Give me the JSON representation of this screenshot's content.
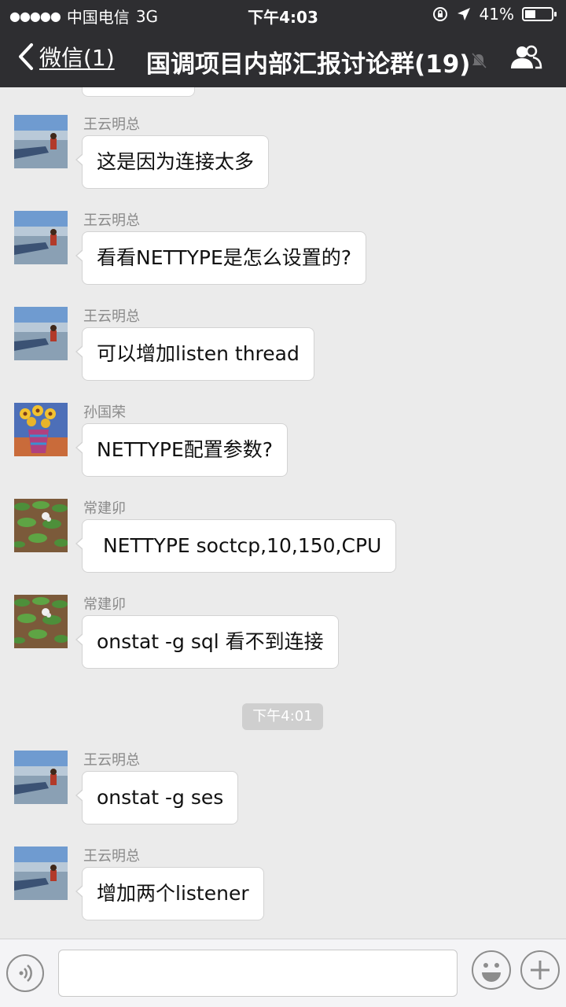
{
  "status_bar": {
    "signal_dots": "●●●●●",
    "carrier": "中国电信",
    "network": "3G",
    "time": "下午4:03",
    "battery_percent": "41%",
    "battery_level": 0.41
  },
  "nav": {
    "back_label": "微信(1)",
    "title": "国调项目内部汇报讨论群(19)"
  },
  "messages": [
    {
      "sender": "王云明总",
      "text": "这是因为连接太多",
      "avatar": "lake-avatar"
    },
    {
      "sender": "王云明总",
      "text": "看看NETTYPE是怎么设置的?",
      "avatar": "lake-avatar"
    },
    {
      "sender": "王云明总",
      "text": "可以增加listen thread",
      "avatar": "lake-avatar"
    },
    {
      "sender": "孙国荣",
      "text": "NETTYPE配置参数?",
      "avatar": "flower-avatar"
    },
    {
      "sender": "常建卯",
      "text": " NETTYPE soctcp,10,150,CPU",
      "avatar": "plants-avatar"
    },
    {
      "sender": "常建卯",
      "text": "onstat -g sql 看不到连接",
      "avatar": "plants-avatar"
    },
    {
      "sender": "王云明总",
      "text": "onstat -g ses",
      "avatar": "lake-avatar"
    },
    {
      "sender": "王云明总",
      "text": "增加两个listener",
      "avatar": "lake-avatar"
    }
  ],
  "time_divider": "下午4:01",
  "input": {
    "value": "",
    "placeholder": ""
  },
  "colors": {
    "header_bg": "#2e2e31",
    "chat_bg": "#ebebeb",
    "bubble_bg": "#ffffff",
    "time_pill_bg": "#cfcfcf"
  }
}
